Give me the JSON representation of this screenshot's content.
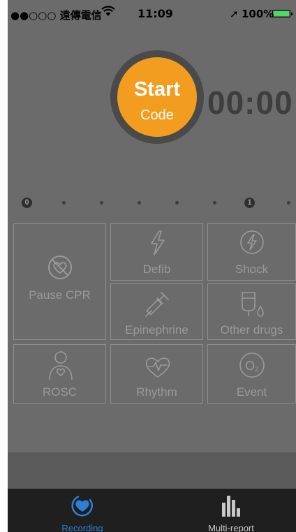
{
  "statusbar": {
    "carrier": "●●○○○ 遠傳電信",
    "wifi_icon": "wifi-icon",
    "time": "11:09",
    "location_arrow": "➚",
    "battery_percent": "100%",
    "battery_level": 1.0
  },
  "start_button": {
    "line1": "Start",
    "line2": "Code"
  },
  "timer": "00:00",
  "progress": {
    "markers": [
      "0",
      "1"
    ]
  },
  "tiles": {
    "pause_cpr": "Pause CPR",
    "defib": "Defib",
    "shock": "Shock",
    "epinephrine": "Epinephrine",
    "other_drugs": "Other drugs",
    "rosc": "ROSC",
    "rhythm": "Rhythm",
    "event": "Event"
  },
  "tabbar": {
    "recording": "Recording",
    "multi_report": "Multi-report"
  },
  "colors": {
    "accent_orange": "#f29d1f",
    "tab_active_blue": "#2d7fd6",
    "tab_inactive": "#c8c8c8",
    "overlay_gray": "#6b6b6b"
  }
}
